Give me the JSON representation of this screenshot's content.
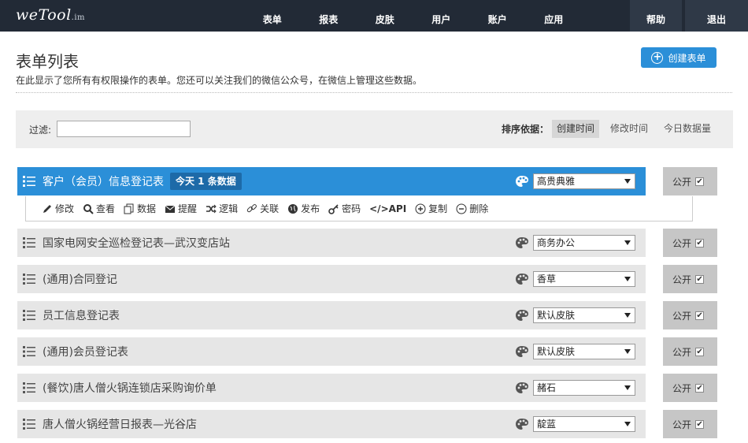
{
  "app": {
    "logo": "weTool",
    "logo_suffix": ".im"
  },
  "nav": {
    "items": [
      "表单",
      "报表",
      "皮肤",
      "用户",
      "账户",
      "应用"
    ],
    "help": "帮助",
    "logout": "退出"
  },
  "header": {
    "title": "表单列表",
    "description": "在此显示了您所有有权限操作的表单。您还可以关注我们的微信公众号，在微信上管理这些数据。",
    "create_button": "创建表单"
  },
  "filter": {
    "label": "过滤:",
    "value": ""
  },
  "sort": {
    "label": "排序依据：",
    "options": [
      "创建时间",
      "修改时间",
      "今日数据量"
    ],
    "active": "创建时间"
  },
  "forms": [
    {
      "name": "客户（会员）信息登记表",
      "badge": "今天 1 条数据",
      "skin": "高贵典雅",
      "public_label": "公开",
      "public_checked": true,
      "active": true
    },
    {
      "name": "国家电网安全巡检登记表—武汉变店站",
      "skin": "商务办公",
      "public_label": "公开",
      "public_checked": true
    },
    {
      "name": "(通用)合同登记",
      "skin": "香草",
      "public_label": "公开",
      "public_checked": true
    },
    {
      "name": "员工信息登记表",
      "skin": "默认皮肤",
      "public_label": "公开",
      "public_checked": true
    },
    {
      "name": "(通用)会员登记表",
      "skin": "默认皮肤",
      "public_label": "公开",
      "public_checked": true
    },
    {
      "name": "(餐饮)唐人僧火锅连锁店采购询价单",
      "skin": "赭石",
      "public_label": "公开",
      "public_checked": true
    },
    {
      "name": "唐人僧火锅经营日报表—光谷店",
      "skin": "靛蓝",
      "public_label": "公开",
      "public_checked": true
    }
  ],
  "actions": [
    "修改",
    "查看",
    "数据",
    "提醒",
    "逻辑",
    "关联",
    "发布",
    "密码",
    "API",
    "复制",
    "删除"
  ],
  "colors": {
    "navbar": "#222a36",
    "accent": "#2b8fd8",
    "badge": "#1d6aa8"
  }
}
